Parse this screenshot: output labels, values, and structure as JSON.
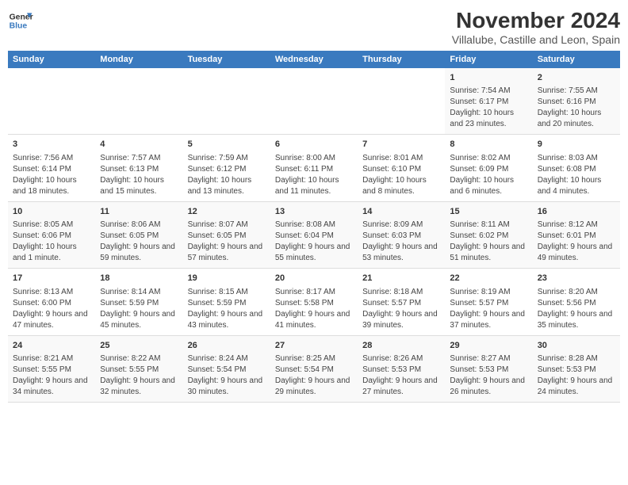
{
  "header": {
    "logo_line1": "General",
    "logo_line2": "Blue",
    "month_title": "November 2024",
    "subtitle": "Villalube, Castille and Leon, Spain"
  },
  "days_of_week": [
    "Sunday",
    "Monday",
    "Tuesday",
    "Wednesday",
    "Thursday",
    "Friday",
    "Saturday"
  ],
  "weeks": [
    [
      {
        "day": "",
        "info": ""
      },
      {
        "day": "",
        "info": ""
      },
      {
        "day": "",
        "info": ""
      },
      {
        "day": "",
        "info": ""
      },
      {
        "day": "",
        "info": ""
      },
      {
        "day": "1",
        "info": "Sunrise: 7:54 AM\nSunset: 6:17 PM\nDaylight: 10 hours and 23 minutes."
      },
      {
        "day": "2",
        "info": "Sunrise: 7:55 AM\nSunset: 6:16 PM\nDaylight: 10 hours and 20 minutes."
      }
    ],
    [
      {
        "day": "3",
        "info": "Sunrise: 7:56 AM\nSunset: 6:14 PM\nDaylight: 10 hours and 18 minutes."
      },
      {
        "day": "4",
        "info": "Sunrise: 7:57 AM\nSunset: 6:13 PM\nDaylight: 10 hours and 15 minutes."
      },
      {
        "day": "5",
        "info": "Sunrise: 7:59 AM\nSunset: 6:12 PM\nDaylight: 10 hours and 13 minutes."
      },
      {
        "day": "6",
        "info": "Sunrise: 8:00 AM\nSunset: 6:11 PM\nDaylight: 10 hours and 11 minutes."
      },
      {
        "day": "7",
        "info": "Sunrise: 8:01 AM\nSunset: 6:10 PM\nDaylight: 10 hours and 8 minutes."
      },
      {
        "day": "8",
        "info": "Sunrise: 8:02 AM\nSunset: 6:09 PM\nDaylight: 10 hours and 6 minutes."
      },
      {
        "day": "9",
        "info": "Sunrise: 8:03 AM\nSunset: 6:08 PM\nDaylight: 10 hours and 4 minutes."
      }
    ],
    [
      {
        "day": "10",
        "info": "Sunrise: 8:05 AM\nSunset: 6:06 PM\nDaylight: 10 hours and 1 minute."
      },
      {
        "day": "11",
        "info": "Sunrise: 8:06 AM\nSunset: 6:05 PM\nDaylight: 9 hours and 59 minutes."
      },
      {
        "day": "12",
        "info": "Sunrise: 8:07 AM\nSunset: 6:05 PM\nDaylight: 9 hours and 57 minutes."
      },
      {
        "day": "13",
        "info": "Sunrise: 8:08 AM\nSunset: 6:04 PM\nDaylight: 9 hours and 55 minutes."
      },
      {
        "day": "14",
        "info": "Sunrise: 8:09 AM\nSunset: 6:03 PM\nDaylight: 9 hours and 53 minutes."
      },
      {
        "day": "15",
        "info": "Sunrise: 8:11 AM\nSunset: 6:02 PM\nDaylight: 9 hours and 51 minutes."
      },
      {
        "day": "16",
        "info": "Sunrise: 8:12 AM\nSunset: 6:01 PM\nDaylight: 9 hours and 49 minutes."
      }
    ],
    [
      {
        "day": "17",
        "info": "Sunrise: 8:13 AM\nSunset: 6:00 PM\nDaylight: 9 hours and 47 minutes."
      },
      {
        "day": "18",
        "info": "Sunrise: 8:14 AM\nSunset: 5:59 PM\nDaylight: 9 hours and 45 minutes."
      },
      {
        "day": "19",
        "info": "Sunrise: 8:15 AM\nSunset: 5:59 PM\nDaylight: 9 hours and 43 minutes."
      },
      {
        "day": "20",
        "info": "Sunrise: 8:17 AM\nSunset: 5:58 PM\nDaylight: 9 hours and 41 minutes."
      },
      {
        "day": "21",
        "info": "Sunrise: 8:18 AM\nSunset: 5:57 PM\nDaylight: 9 hours and 39 minutes."
      },
      {
        "day": "22",
        "info": "Sunrise: 8:19 AM\nSunset: 5:57 PM\nDaylight: 9 hours and 37 minutes."
      },
      {
        "day": "23",
        "info": "Sunrise: 8:20 AM\nSunset: 5:56 PM\nDaylight: 9 hours and 35 minutes."
      }
    ],
    [
      {
        "day": "24",
        "info": "Sunrise: 8:21 AM\nSunset: 5:55 PM\nDaylight: 9 hours and 34 minutes."
      },
      {
        "day": "25",
        "info": "Sunrise: 8:22 AM\nSunset: 5:55 PM\nDaylight: 9 hours and 32 minutes."
      },
      {
        "day": "26",
        "info": "Sunrise: 8:24 AM\nSunset: 5:54 PM\nDaylight: 9 hours and 30 minutes."
      },
      {
        "day": "27",
        "info": "Sunrise: 8:25 AM\nSunset: 5:54 PM\nDaylight: 9 hours and 29 minutes."
      },
      {
        "day": "28",
        "info": "Sunrise: 8:26 AM\nSunset: 5:53 PM\nDaylight: 9 hours and 27 minutes."
      },
      {
        "day": "29",
        "info": "Sunrise: 8:27 AM\nSunset: 5:53 PM\nDaylight: 9 hours and 26 minutes."
      },
      {
        "day": "30",
        "info": "Sunrise: 8:28 AM\nSunset: 5:53 PM\nDaylight: 9 hours and 24 minutes."
      }
    ]
  ]
}
